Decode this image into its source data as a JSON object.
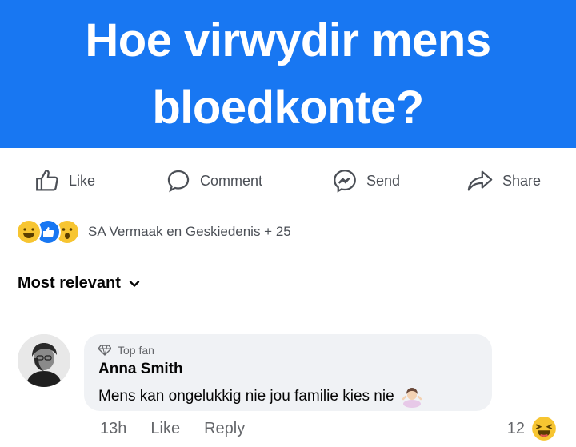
{
  "banner": {
    "title": "Hoe virwydir mens bloedkonte?",
    "color": "#1877f2"
  },
  "actions": [
    {
      "label": "Like",
      "icon": "thumbs-up-icon"
    },
    {
      "label": "Comment",
      "icon": "comment-icon"
    },
    {
      "label": "Send",
      "icon": "messenger-icon"
    },
    {
      "label": "Share",
      "icon": "share-icon"
    }
  ],
  "reactions": {
    "icons": [
      "laugh-emoji-icon",
      "like-emoji-icon",
      "wow-emoji-icon"
    ],
    "text": "SA Vermaak en Geskiedenis + 25"
  },
  "sort": {
    "label": "Most relevant",
    "icon": "chevron-down-icon"
  },
  "comment": {
    "badge": "Top fan",
    "badge_icon": "top-fan-badge-icon",
    "author": "Anna Smith",
    "text": "Mens kan ongelukkig nie jou familie kies nie",
    "emoji_icon": "person-shrugging-emoji-icon",
    "time": "13h",
    "like": "Like",
    "reply": "Reply",
    "reaction_count": "12",
    "reaction_icon": "laugh-emoji-icon"
  }
}
